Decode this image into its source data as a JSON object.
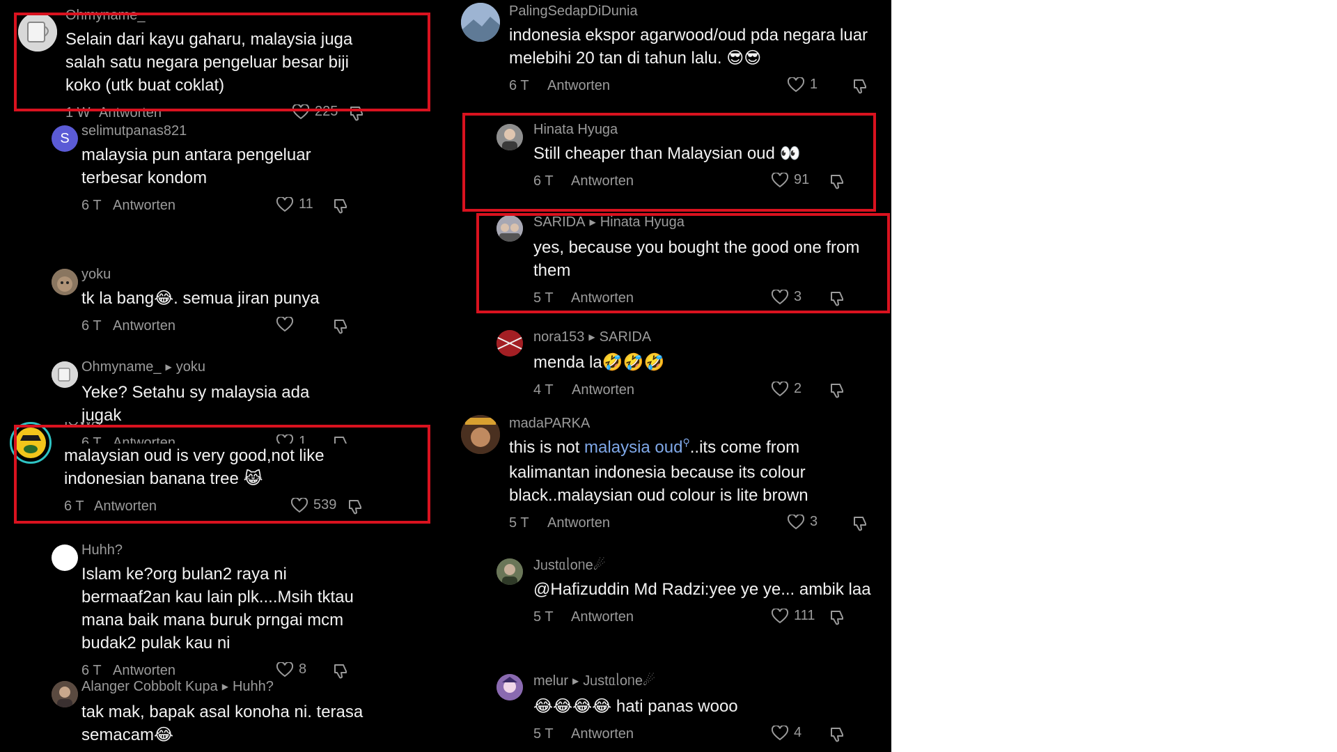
{
  "reply_label": "Antworten",
  "colors": {
    "highlight": "#d9121f",
    "background": "#000000",
    "link": "#7fa8e8"
  },
  "left_comments": [
    {
      "user": "Ohmyname_",
      "reply_to": "",
      "text": "Selain dari kayu gaharu, malaysia juga salah satu negara pengeluar besar biji koko (utk buat coklat)",
      "age": "1 W",
      "likes": "225",
      "avatar": "mug-avatar",
      "highlighted": true
    },
    {
      "user": "selimutpanas821",
      "reply_to": "",
      "text": "malaysia pun antara pengeluar terbesar kondom",
      "age": "6 T",
      "likes": "11",
      "avatar": "letter-s-avatar",
      "avatar_letter": "S"
    },
    {
      "user": "yoku",
      "reply_to": "",
      "text": "tk la bang😂. semua jiran punya",
      "age": "6 T",
      "likes": "",
      "avatar": "cat-avatar"
    },
    {
      "user": "Ohmyname_",
      "reply_to": "yoku",
      "text": "Yeke? Setahu sy malaysia ada jugak",
      "age": "6 T",
      "likes": "1",
      "avatar": "mug-avatar"
    },
    {
      "user": "IOWA",
      "reply_to": "",
      "text": "malaysian oud is very good,not like indonesian banana tree 😹",
      "age": "6 T",
      "likes": "539",
      "avatar": "yellow-character-avatar",
      "highlighted": true
    },
    {
      "user": "Huhh?",
      "reply_to": "",
      "text": "Islam ke?org bulan2 raya ni bermaaf2an kau lain plk....Msih tktau mana baik mana buruk prngai mcm budak2 pulak kau ni",
      "age": "6 T",
      "likes": "8",
      "avatar": "white-circle-avatar"
    },
    {
      "user": "Alanger Cobbolt Kupa",
      "reply_to": "Huhh?",
      "text": "tak mak, bapak asal konoha ni. terasa semacam😂",
      "age": "",
      "likes": "",
      "avatar": "person-avatar"
    }
  ],
  "right_comments": [
    {
      "user": "PalingSedapDiDunia",
      "reply_to": "",
      "text": "indonesia ekspor agarwood/oud pda negara luar melebihi 20 tan di tahun lalu. 😎😎",
      "age": "6 T",
      "likes": "1",
      "avatar": "landscape-avatar"
    },
    {
      "user": "Hinata Hyuga",
      "reply_to": "",
      "text": "Still cheaper than Malaysian oud 👀",
      "age": "6 T",
      "likes": "91",
      "avatar": "person-avatar",
      "highlighted": true
    },
    {
      "user": "SARIDA",
      "reply_to": "Hinata Hyuga",
      "text": "yes, because you bought the good one from them",
      "age": "5 T",
      "likes": "3",
      "avatar": "group-avatar",
      "highlighted": true
    },
    {
      "user": "nora153",
      "reply_to": "SARIDA",
      "text": "menda la🤣🤣🤣",
      "age": "4 T",
      "likes": "2",
      "avatar": "red-pattern-avatar"
    },
    {
      "user": "madaPARKA",
      "reply_to": "",
      "text_pre": "this is not ",
      "text_link": "malaysia oud",
      "text_post": "..its come from kalimantan indonesia because its colour black..malaysian oud colour is lite brown",
      "age": "5 T",
      "likes": "3",
      "avatar": "portrait-avatar"
    },
    {
      "user": "Jᥙstᥲᥣoᥒe☄",
      "reply_to": "",
      "text": "@Hafizuddin Md Radzi:yee ye ye... ambik laa",
      "age": "5 T",
      "likes": "111",
      "avatar": "person-avatar"
    },
    {
      "user": "melur",
      "reply_to": "Jᥙstᥲᥣoᥒe☄",
      "text": "😂😂😂😂 hati panas wooo",
      "age": "5 T",
      "likes": "4",
      "avatar": "anime-avatar"
    }
  ]
}
